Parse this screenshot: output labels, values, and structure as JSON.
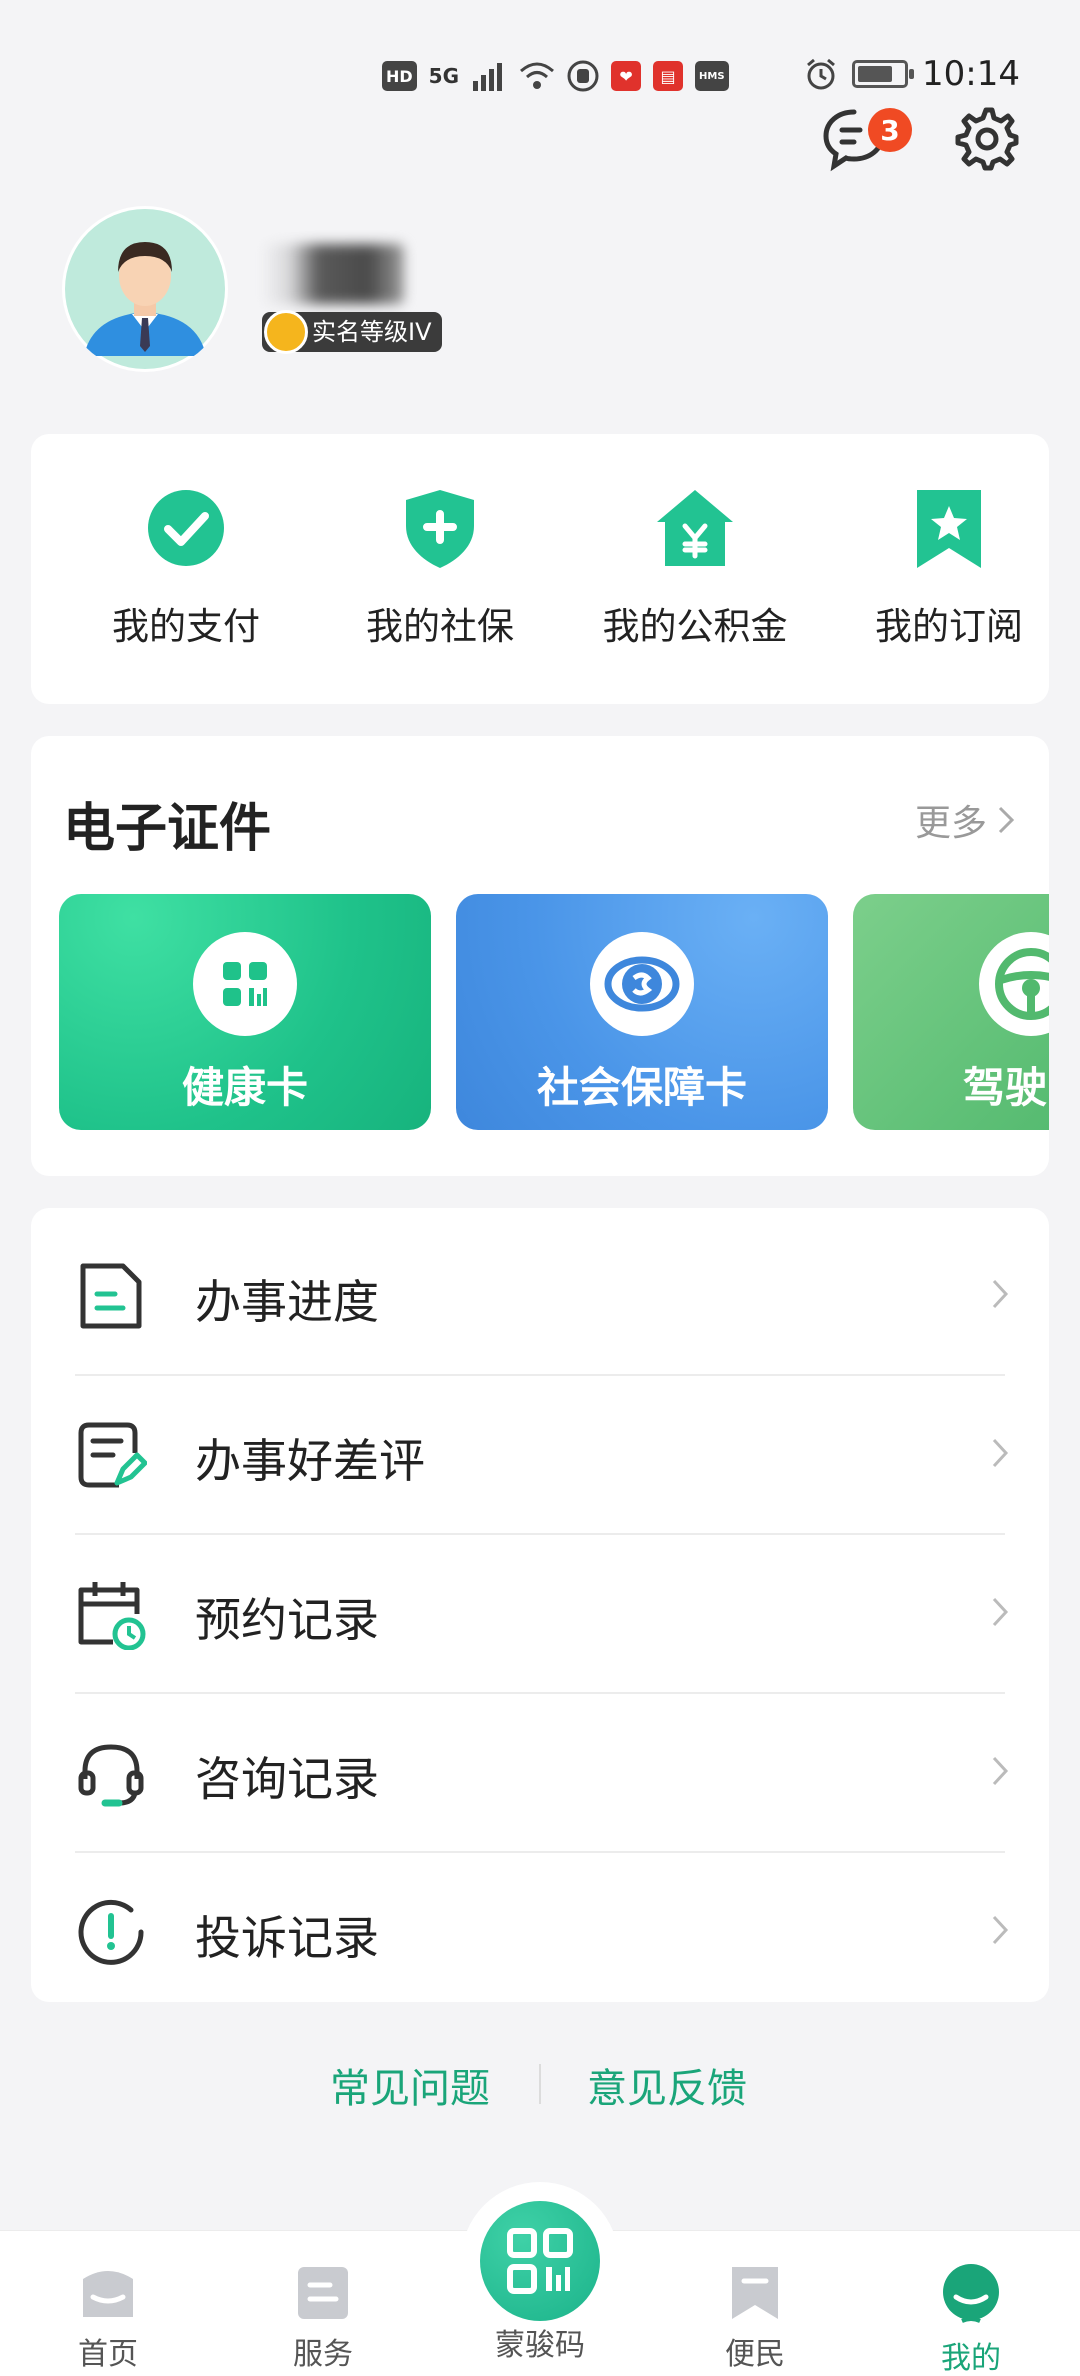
{
  "status_bar": {
    "icons": [
      "HD",
      "5G",
      "HMS"
    ],
    "time": "10:14"
  },
  "header": {
    "message_badge": "3"
  },
  "profile": {
    "verify_label": "实名等级IV"
  },
  "quick_actions": [
    {
      "label": "我的支付",
      "icon": "check-circle-icon"
    },
    {
      "label": "我的社保",
      "icon": "shield-plus-icon"
    },
    {
      "label": "我的公积金",
      "icon": "house-yuan-icon"
    },
    {
      "label": "我的订阅",
      "icon": "bookmark-star-icon"
    }
  ],
  "certificates": {
    "title": "电子证件",
    "more": "更多",
    "items": [
      {
        "label": "健康卡",
        "color": "#1fc28a"
      },
      {
        "label": "社会保障卡",
        "color": "#4a95e8"
      },
      {
        "label": "驾驶",
        "color": "#52b96e"
      }
    ]
  },
  "records": [
    {
      "label": "办事进度",
      "icon": "document-icon"
    },
    {
      "label": "办事好差评",
      "icon": "review-edit-icon"
    },
    {
      "label": "预约记录",
      "icon": "calendar-clock-icon"
    },
    {
      "label": "咨询记录",
      "icon": "headset-icon"
    },
    {
      "label": "投诉记录",
      "icon": "exclamation-circle-icon"
    }
  ],
  "footer": {
    "faq": "常见问题",
    "feedback": "意见反馈"
  },
  "bottom_nav": {
    "home": "首页",
    "services": "服务",
    "code": "蒙骏码",
    "convenience": "便民",
    "mine": "我的"
  },
  "colors": {
    "accent": "#1aa579",
    "badge": "#f04a23"
  }
}
